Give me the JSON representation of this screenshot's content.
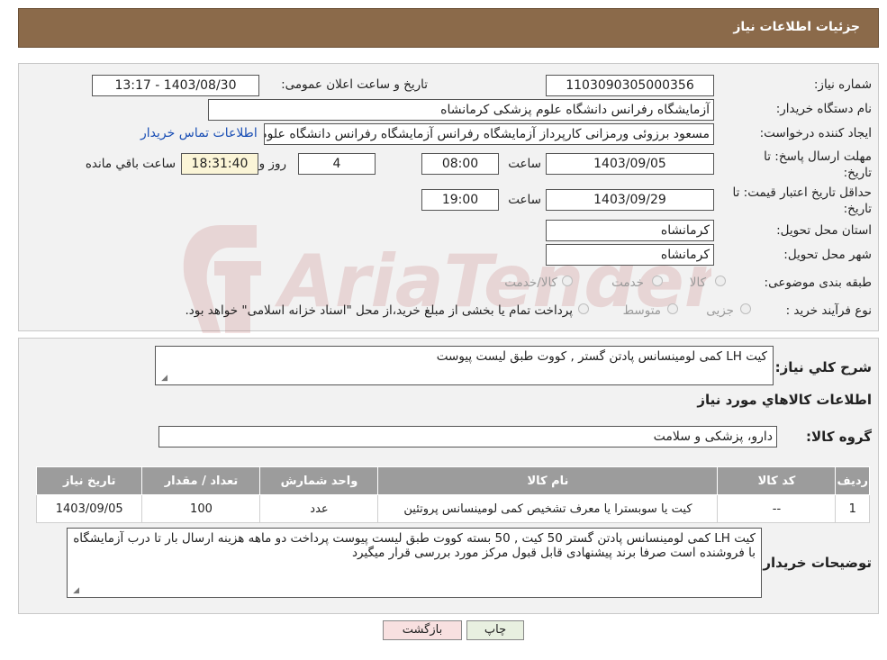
{
  "header": {
    "title": "جزئیات اطلاعات نیاز"
  },
  "form": {
    "need_number_label": "شماره نیاز:",
    "need_number": "1103090305000356",
    "announce_label": "تاریخ و ساعت اعلان عمومی:",
    "announce_value": "1403/08/30 - 13:17",
    "buyer_org_label": "نام دستگاه خریدار:",
    "buyer_org": "آزمایشگاه رفرانس دانشگاه علوم پزشکی کرمانشاه",
    "creator_label": "ایجاد کننده درخواست:",
    "creator": "مسعود برزوئی ورمزانی کارپرداز آزمایشگاه رفرانس آزمایشگاه رفرانس دانشگاه علوم پزشکی کرمانشاه",
    "contact_link": "اطلاعات تماس خریدار",
    "reply_deadline_label_1": "مهلت ارسال پاسخ: تا",
    "reply_deadline_label_2": "تاریخ:",
    "reply_date": "1403/09/05",
    "time_label": "ساعت",
    "reply_time": "08:00",
    "days_value": "4",
    "days_label": "روز و",
    "remaining_time": "18:31:40",
    "remaining_label": "ساعت باقي مانده",
    "validity_label_1": "حداقل تاریخ اعتبار قیمت: تا",
    "validity_label_2": "تاریخ:",
    "validity_date": "1403/09/29",
    "validity_time": "19:00",
    "province_label": "استان محل تحویل:",
    "province": "کرمانشاه",
    "city_label": "شهر محل تحویل:",
    "city": "کرمانشاه",
    "category_label": "طبقه بندی موضوعی:",
    "category_options": [
      "کالا",
      "خدمت",
      "کالا/خدمت"
    ],
    "process_label": "نوع فرآیند خرید :",
    "process_options": [
      "جزیی",
      "متوسط"
    ],
    "process_note": "پرداخت تمام یا بخشی از مبلغ خرید،از محل \"اسناد خزانه اسلامی\" خواهد بود."
  },
  "details": {
    "summary_label": "شرح کلي نیاز:",
    "summary": "کیت LH کمی لومینسانس پادتن گستر , کووت طبق لیست پیوست",
    "items_title": "اطلاعات کالاهاي مورد نیاز",
    "group_label": "گروه کالا:",
    "group_value": "دارو، پزشکی و سلامت",
    "table": {
      "headers": [
        "ردیف",
        "کد کالا",
        "نام کالا",
        "واحد شمارش",
        "تعداد / مقدار",
        "تاریخ نیاز"
      ],
      "rows": [
        [
          "1",
          "--",
          "کیت یا سوبسترا یا معرف تشخیص کمی لومینسانس پروتئین",
          "عدد",
          "100",
          "1403/09/05"
        ]
      ]
    },
    "buyer_notes_label": "توضیحات خریدار:",
    "buyer_notes": "کیت LH کمی لومینسانس پادتن گستر 50 کیت , 50 بسته کووت طبق لیست پیوست پرداخت دو ماهه هزینه ارسال بار تا درب آزمایشگاه با فروشنده است صرفا برند پیشنهادی قابل قبول مرکز مورد بررسی قرار میگیرد"
  },
  "buttons": {
    "print": "چاپ",
    "back": "بازگشت"
  },
  "watermark": {
    "text": "AriaTender.neT"
  },
  "colors": {
    "header_bg": "#8b6a4a",
    "table_header_bg": "#9c9c9c",
    "link": "#1a4fb5",
    "back_button_bg": "#f8e0e0"
  }
}
